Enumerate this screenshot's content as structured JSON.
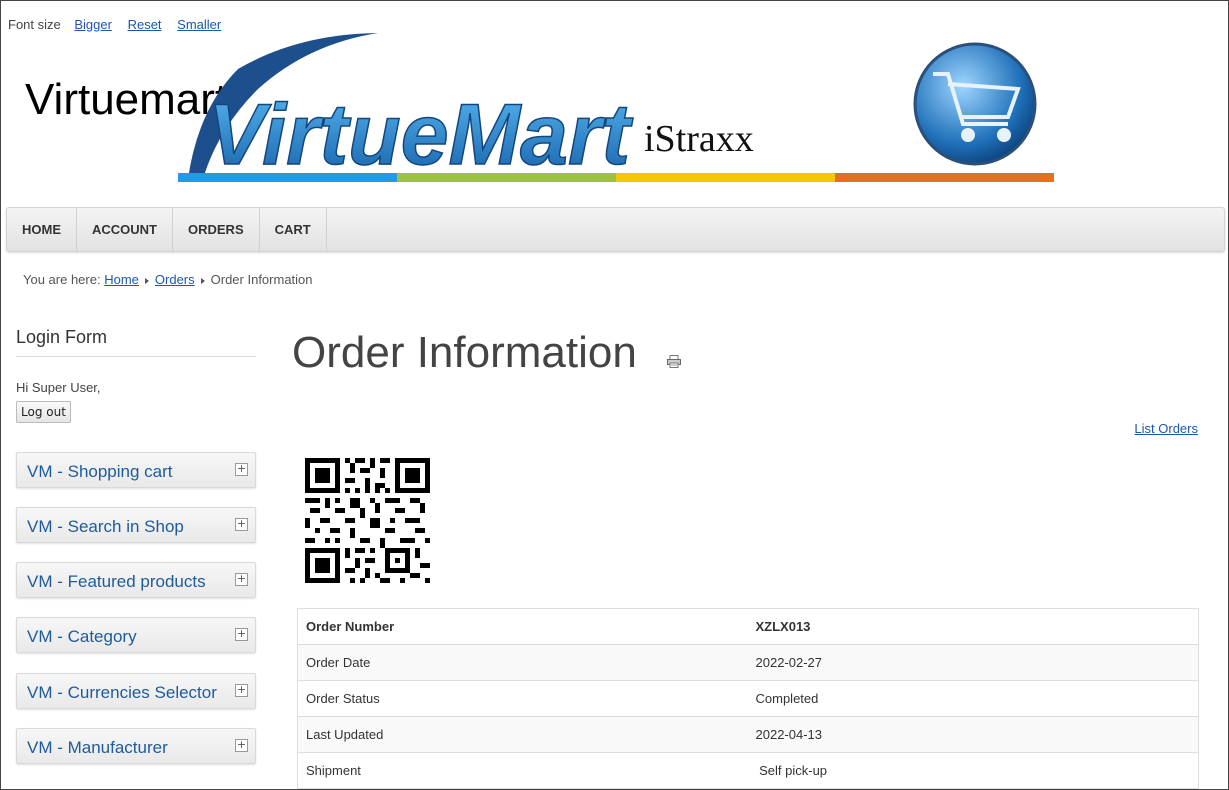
{
  "fontsize": {
    "label": "Font size",
    "bigger": "Bigger",
    "reset": "Reset",
    "smaller": "Smaller"
  },
  "site": {
    "title": "Virtuemart",
    "banner_text": "VirtueMart",
    "banner_sub": "iStraxx"
  },
  "nav": {
    "items": [
      "HOME",
      "ACCOUNT",
      "ORDERS",
      "CART"
    ]
  },
  "breadcrumb": {
    "prefix": "You are here:",
    "home": "Home",
    "orders": "Orders",
    "current": "Order Information"
  },
  "sidebar": {
    "login_title": "Login Form",
    "greeting": "Hi Super User,",
    "logout": "Log out",
    "modules": [
      "VM - Shopping cart",
      "VM - Search in Shop",
      "VM - Featured products",
      "VM - Category",
      "VM - Currencies Selector",
      "VM - Manufacturer"
    ]
  },
  "main": {
    "title": "Order Information",
    "list_orders": "List Orders",
    "details": [
      {
        "label": "Order Number",
        "value": "XZLX013"
      },
      {
        "label": "Order Date",
        "value": "2022-02-27"
      },
      {
        "label": "Order Status",
        "value": "Completed"
      },
      {
        "label": "Last Updated",
        "value": "2022-04-13"
      },
      {
        "label": "Shipment",
        "value": " Self pick-up"
      }
    ]
  },
  "colors": {
    "link": "#1b57b1",
    "module_title": "#1e5b9b",
    "stripe": [
      "#1aa0e0",
      "#9cc33b",
      "#f4c800",
      "#e2701c"
    ]
  }
}
